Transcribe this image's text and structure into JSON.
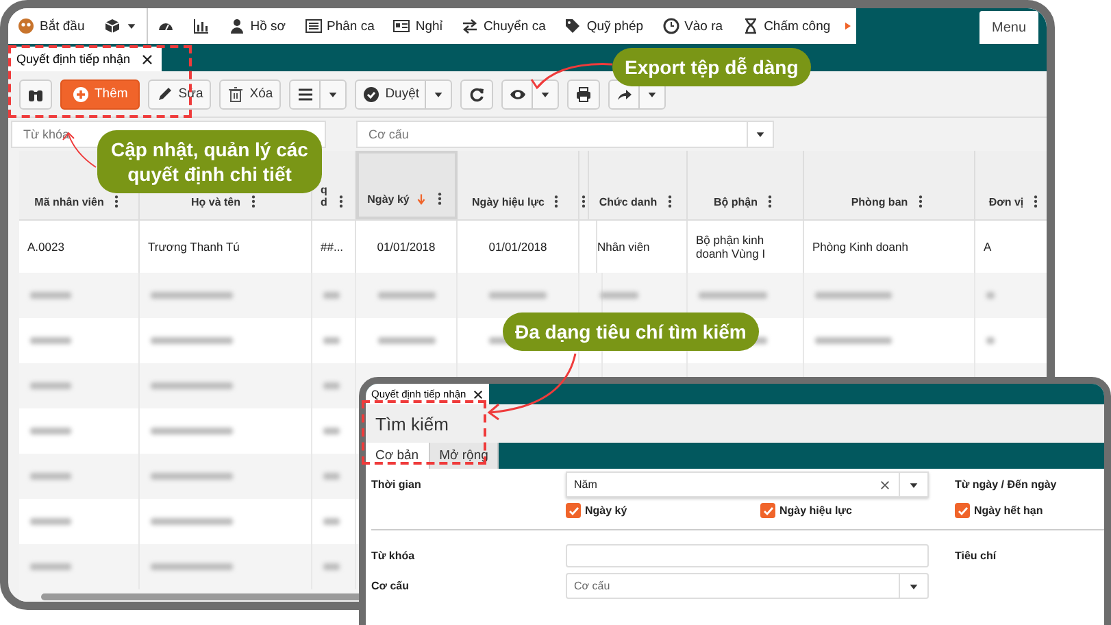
{
  "menubar": {
    "items": [
      {
        "kind": "labeled",
        "label": "Bắt đầu",
        "dropdown": false
      },
      {
        "kind": "icon",
        "dropdown": true
      },
      {
        "kind": "icon",
        "dropdown": false
      },
      {
        "kind": "icon",
        "dropdown": false
      },
      {
        "kind": "labeled",
        "label": "Hồ sơ",
        "dropdown": false
      },
      {
        "kind": "labeled",
        "label": "Phân ca",
        "dropdown": false
      },
      {
        "kind": "labeled",
        "label": "Nghỉ",
        "dropdown": false
      },
      {
        "kind": "labeled",
        "label": "Chuyển ca",
        "dropdown": false
      },
      {
        "kind": "labeled",
        "label": "Quỹ phép",
        "dropdown": false
      },
      {
        "kind": "labeled",
        "label": "Vào ra",
        "dropdown": false
      },
      {
        "kind": "labeled",
        "label": "Chấm công",
        "dropdown": false
      }
    ],
    "menu_button": "Menu"
  },
  "tabs": [
    {
      "label": "Quyết định tiếp nhận",
      "selected": true
    }
  ],
  "toolbar": [
    {
      "kind": "icon",
      "dropdown": false
    },
    {
      "kind": "primary",
      "label": "Thêm",
      "dropdown": false
    },
    {
      "kind": "normal",
      "label": "Sửa",
      "dropdown": false
    },
    {
      "kind": "normal",
      "label": "Xóa",
      "dropdown": false
    },
    {
      "kind": "icon",
      "dropdown": true
    },
    {
      "kind": "normal",
      "label": "Duyệt",
      "dropdown": true
    },
    {
      "kind": "icon",
      "dropdown": false
    },
    {
      "kind": "icon",
      "dropdown": true
    },
    {
      "kind": "icon",
      "dropdown": false
    },
    {
      "kind": "icon",
      "dropdown": true
    }
  ],
  "filters": {
    "keyword": {
      "placeholder": "Từ khóa"
    },
    "structure": {
      "placeholder": "Cơ cấu"
    }
  },
  "table": {
    "columns": [
      {
        "kind": "label",
        "label": "Mã nhân viên",
        "sorted": false
      },
      {
        "kind": "label",
        "label": "Họ và tên",
        "sorted": false
      },
      {
        "kind": "label",
        "label": "q d",
        "sorted": false
      },
      {
        "kind": "label",
        "label": "Ngày ký",
        "sorted": true
      },
      {
        "kind": "label",
        "label": "Ngày hiệu lực",
        "sorted": false
      },
      {
        "kind": "spacer",
        "sorted": false
      },
      {
        "kind": "label",
        "label": "Chức danh",
        "sorted": false
      },
      {
        "kind": "label",
        "label": "Bộ phận",
        "sorted": false
      },
      {
        "kind": "label",
        "label": "Phòng ban",
        "sorted": false
      },
      {
        "kind": "label",
        "label": "Đơn vị",
        "sorted": false
      }
    ],
    "rows": [
      {
        "kind": "clear",
        "cells": [
          "A.0023",
          "Trương Thanh Tú",
          "##...",
          "01/01/2018",
          "01/01/2018",
          null,
          "Nhân viên",
          "Bộ phận kinh doanh Vùng I",
          "Phòng Kinh doanh",
          "A"
        ]
      },
      {
        "kind": "blurred"
      },
      {
        "kind": "blurred"
      },
      {
        "kind": "blurred"
      },
      {
        "kind": "blurred"
      },
      {
        "kind": "blurred"
      },
      {
        "kind": "blurred"
      },
      {
        "kind": "blurred"
      }
    ]
  },
  "search_window": {
    "tab": "Quyết định tiếp nhận",
    "title": "Tìm kiếm",
    "tabs": [
      {
        "label": "Cơ bản",
        "selected": true
      },
      {
        "label": "Mở rộng",
        "selected": false
      }
    ],
    "time_label": "Thời gian",
    "time_value": "Năm",
    "date_range_label": "Từ ngày / Đến ngày",
    "checks": [
      {
        "label": "Ngày ký",
        "checked": true
      },
      {
        "label": "Ngày hiệu lực",
        "checked": true
      },
      {
        "label": "Ngày hết hạn",
        "checked": true
      }
    ],
    "keyword_label": "Từ khóa",
    "criteria_label": "Tiêu chí",
    "structure_label": "Cơ cấu",
    "structure_placeholder": "Cơ cấu"
  },
  "callouts": [
    "Export tệp dễ dàng",
    "Cập nhật, quản lý các quyết định chi tiết",
    "Đa dạng tiêu chí tìm kiếm"
  ]
}
